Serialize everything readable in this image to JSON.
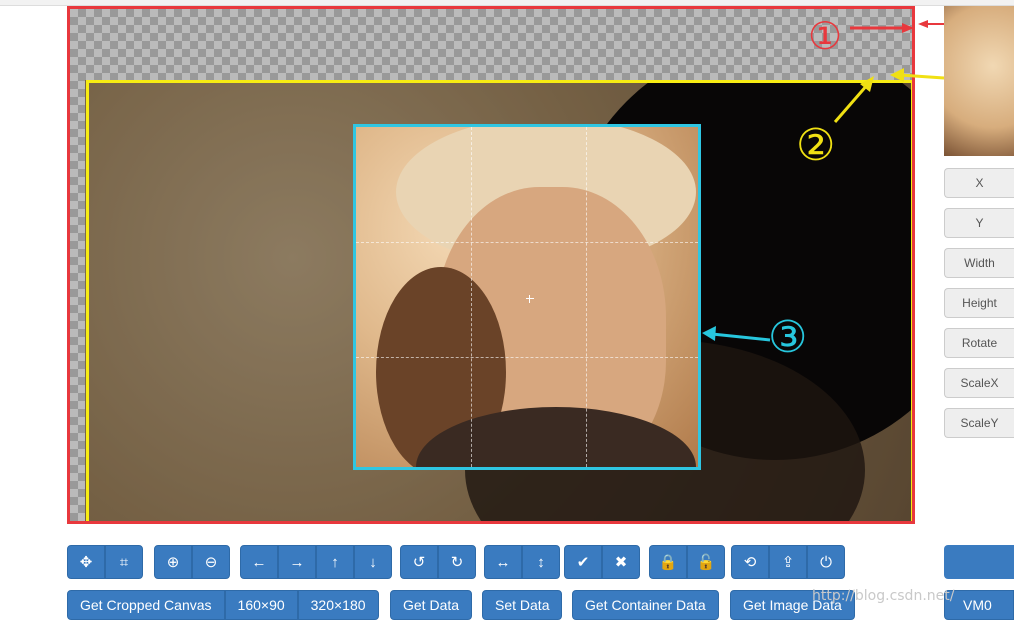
{
  "annotations": {
    "label1": "①",
    "label2": "②",
    "label3": "③"
  },
  "data_fields": [
    {
      "label": "X"
    },
    {
      "label": "Y"
    },
    {
      "label": "Width"
    },
    {
      "label": "Height"
    },
    {
      "label": "Rotate"
    },
    {
      "label": "ScaleX"
    },
    {
      "label": "ScaleY"
    }
  ],
  "toolbar_groups": [
    [
      {
        "icon": "move-icon",
        "glyph": "✥"
      },
      {
        "icon": "crop-icon",
        "glyph": "⌗"
      }
    ],
    [
      {
        "icon": "zoom-in-icon",
        "glyph": "⊕"
      },
      {
        "icon": "zoom-out-icon",
        "glyph": "⊖"
      }
    ],
    [
      {
        "icon": "arrow-left-icon",
        "glyph": "←"
      },
      {
        "icon": "arrow-right-icon",
        "glyph": "→"
      },
      {
        "icon": "arrow-up-icon",
        "glyph": "↑"
      },
      {
        "icon": "arrow-down-icon",
        "glyph": "↓"
      }
    ],
    [
      {
        "icon": "rotate-left-icon",
        "glyph": "↺"
      },
      {
        "icon": "rotate-right-icon",
        "glyph": "↻"
      }
    ],
    [
      {
        "icon": "flip-horizontal-icon",
        "glyph": "↔"
      },
      {
        "icon": "flip-vertical-icon",
        "glyph": "↕"
      }
    ],
    [
      {
        "icon": "crop-confirm-icon",
        "glyph": "✔"
      },
      {
        "icon": "clear-icon",
        "glyph": "✖"
      }
    ],
    [
      {
        "icon": "lock-icon",
        "glyph": "🔒"
      },
      {
        "icon": "unlock-icon",
        "glyph": "🔓"
      }
    ],
    [
      {
        "icon": "reset-icon",
        "glyph": "⟲"
      },
      {
        "icon": "upload-icon",
        "glyph": "⇪"
      },
      {
        "icon": "power-icon",
        "glyph": "⏻"
      }
    ]
  ],
  "bottom_buttons": {
    "get_cropped_canvas": "Get Cropped Canvas",
    "size_160": "160×90",
    "size_320": "320×180",
    "get_data": "Get Data",
    "set_data": "Set Data",
    "get_container_data": "Get Container Data",
    "get_image_data": "Get Image Data",
    "right_partial": "VM0"
  },
  "watermark": "http://blog.csdn.net/",
  "colors": {
    "container_border": "#e8383d",
    "canvas_border": "#f7ec13",
    "cropbox_border": "#2fc6e2",
    "button_blue": "#3a7bc0"
  }
}
